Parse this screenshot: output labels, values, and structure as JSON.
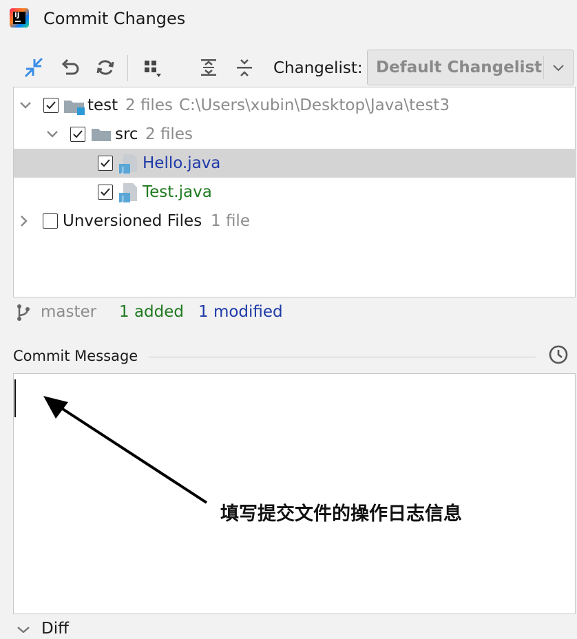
{
  "window": {
    "title": "Commit Changes",
    "app_icon": "intellij-icon"
  },
  "toolbar": {
    "buttons": [
      "show-diff-icon",
      "rollback-icon",
      "refresh-icon",
      "group-by-icon",
      "expand-all-icon",
      "collapse-all-icon"
    ],
    "changelist_label": "Changelist:",
    "changelist_value": "Default Changelist"
  },
  "tree": {
    "root": {
      "name": "test",
      "count": "2 files",
      "path": "C:\\Users\\xubin\\Desktop\\Java\\test3",
      "checked": true
    },
    "src": {
      "name": "src",
      "count": "2 files",
      "checked": true
    },
    "files": [
      {
        "name": "Hello.java",
        "status": "modified",
        "checked": true,
        "selected": true
      },
      {
        "name": "Test.java",
        "status": "added",
        "checked": true,
        "selected": false
      }
    ],
    "unversioned": {
      "name": "Unversioned Files",
      "count": "1 file",
      "checked": false
    }
  },
  "status": {
    "branch": "master",
    "added": "1 added",
    "modified": "1 modified"
  },
  "commit": {
    "label": "Commit Message",
    "value": "",
    "history_icon": "clock-icon"
  },
  "annotation": {
    "text": "填写提交文件的操作日志信息"
  },
  "colors": {
    "added": "#1f7a1f",
    "modified": "#1e3aa8",
    "selected_row": "#d4d4d4"
  },
  "diff": {
    "label": "Diff"
  }
}
